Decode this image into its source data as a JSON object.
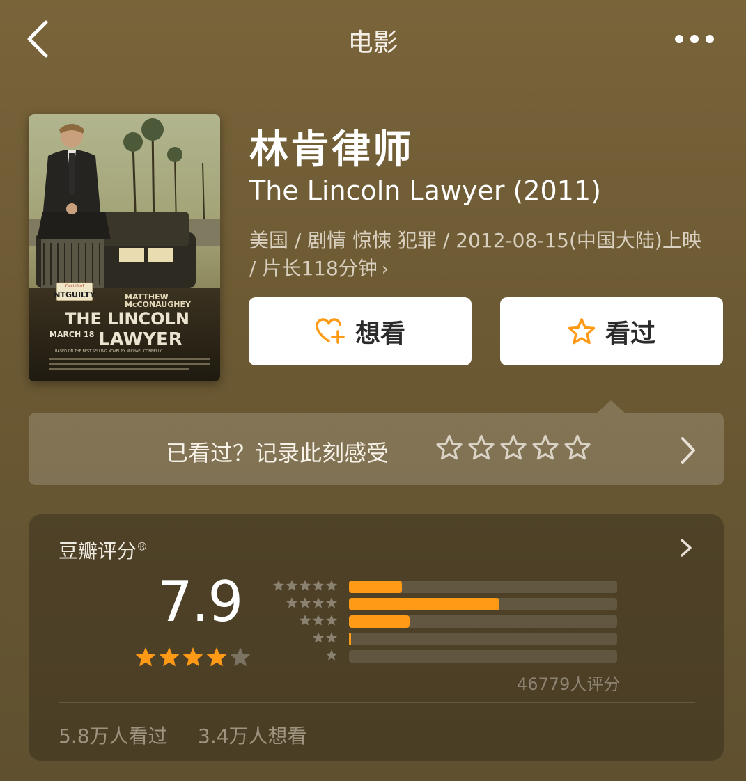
{
  "header": {
    "back_icon": "chevron-left-icon",
    "title": "电影",
    "more_icon": "more-horizontal-icon"
  },
  "poster": {
    "top_text": "Certified",
    "plate": "NTGUILTY",
    "actor_line1": "MATTHEW",
    "actor_line2": "McCONAUGHEY",
    "title_line1": "THE LINCOLN",
    "title_line2": "LAWYER",
    "date": "MARCH 18",
    "credits": "BASED ON THE BEST SELLING NOVEL BY MICHAEL CONNELLY"
  },
  "movie": {
    "title_cn": "林肯律师",
    "title_en": "The Lincoln Lawyer (2011)",
    "meta": "美国 / 剧情 惊悚 犯罪 / 2012-08-15(中国大陆)上映 / 片长118分钟",
    "meta_chevron": "›"
  },
  "actions": {
    "want_label": "想看",
    "want_icon": "heart-plus-icon",
    "seen_label": "看过",
    "seen_icon": "star-outline-icon",
    "accent": "#ff9a16"
  },
  "record": {
    "text": "已看过？记录此刻感受",
    "star_count": 5
  },
  "rating": {
    "title": "豆瓣评分",
    "reg": "®",
    "score": "7.9",
    "stars_value": 4,
    "distribution": [
      {
        "stars": 5,
        "percent": 19.8
      },
      {
        "stars": 4,
        "percent": 56.2
      },
      {
        "stars": 3,
        "percent": 22.6
      },
      {
        "stars": 2,
        "percent": 0.9
      },
      {
        "stars": 1,
        "percent": 0.0
      }
    ],
    "count_text": "46779人评分",
    "seen_count": "5.8万人看过",
    "want_count": "3.4万人想看"
  }
}
